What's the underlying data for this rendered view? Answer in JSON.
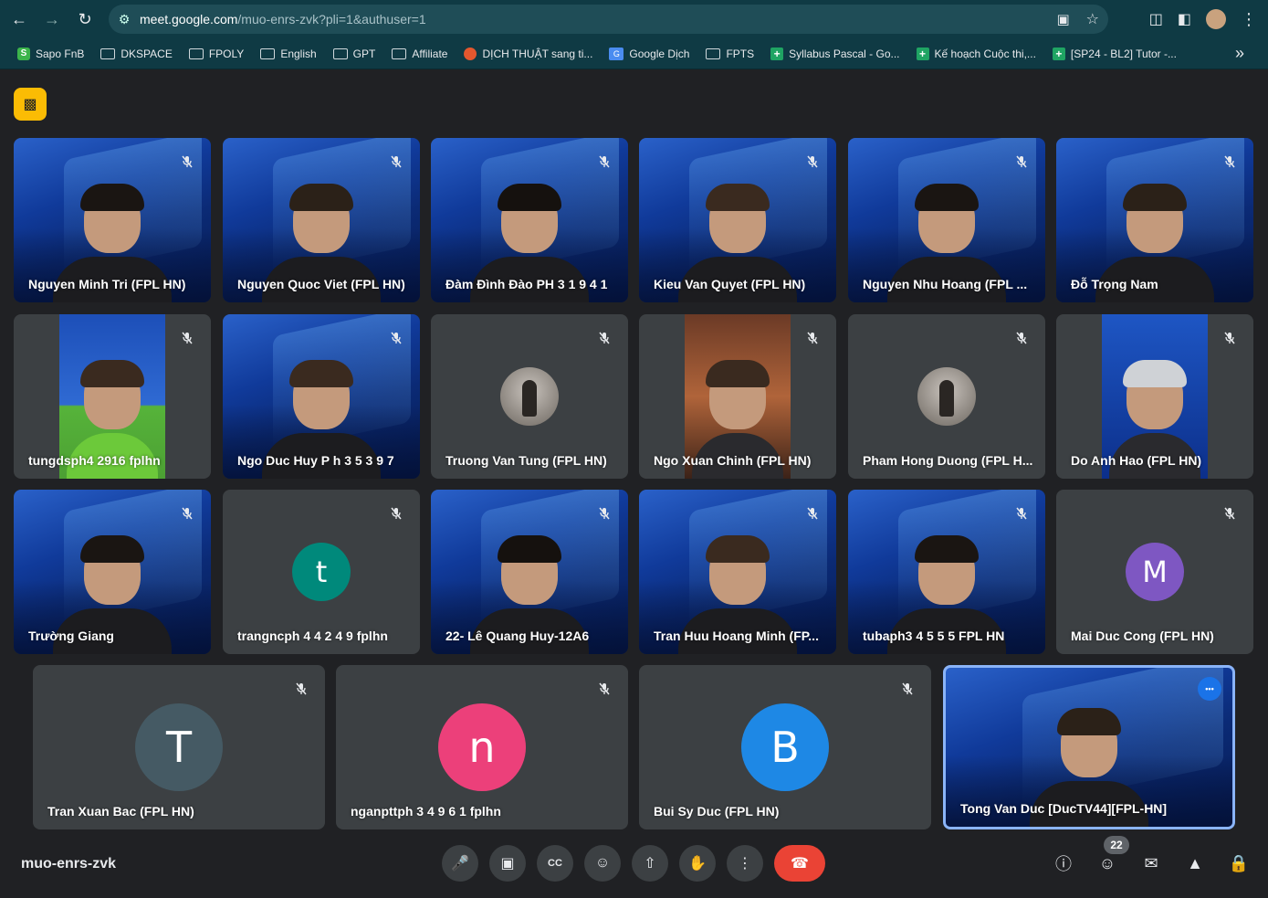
{
  "browser": {
    "url_host": "meet.google.com",
    "url_path": "/muo-enrs-zvk?pli=1&authuser=1",
    "bookmarks": [
      {
        "label": "Sapo FnB",
        "icon": "s-icon"
      },
      {
        "label": "DKSPACE",
        "icon": "folder-icon"
      },
      {
        "label": "FPOLY",
        "icon": "folder-icon"
      },
      {
        "label": "English",
        "icon": "folder-icon"
      },
      {
        "label": "GPT",
        "icon": "folder-icon"
      },
      {
        "label": "Affiliate",
        "icon": "folder-icon"
      },
      {
        "label": "DỊCH THUẬT sang ti...",
        "icon": "translate-site-icon"
      },
      {
        "label": "Google Dịch",
        "icon": "google-translate-icon"
      },
      {
        "label": "FPTS",
        "icon": "folder-icon"
      },
      {
        "label": "Syllabus Pascal - Go...",
        "icon": "sheets-icon"
      },
      {
        "label": "Kế hoạch Cuộc thi,...",
        "icon": "sheets-icon"
      },
      {
        "label": "[SP24 - BL2] Tutor -...",
        "icon": "sheets-icon"
      }
    ],
    "bookmarks_more": "»"
  },
  "participants": [
    {
      "name": "Nguyen Minh Tri (FPL HN)",
      "type": "video"
    },
    {
      "name": "Nguyen Quoc Viet (FPL HN)",
      "type": "video"
    },
    {
      "name": "Đàm Đình Đào PH 3 1 9 4 1",
      "type": "video"
    },
    {
      "name": "Kieu Van Quyet (FPL HN)",
      "type": "video"
    },
    {
      "name": "Nguyen Nhu Hoang (FPL ...",
      "type": "video"
    },
    {
      "name": "Đỗ Trọng Nam",
      "type": "video"
    },
    {
      "name": "tungdsph4 2916 fplhn",
      "type": "strip"
    },
    {
      "name": "Ngo Duc Huy P h 3 5 3 9 7",
      "type": "video"
    },
    {
      "name": "Truong Van Tung (FPL HN)",
      "type": "photo"
    },
    {
      "name": "Ngo Xuan Chinh (FPL HN)",
      "type": "strip"
    },
    {
      "name": "Pham Hong Duong (FPL H...",
      "type": "photo"
    },
    {
      "name": "Do Anh Hao (FPL HN)",
      "type": "strip"
    },
    {
      "name": "Trường Giang",
      "type": "video"
    },
    {
      "name": "trangncph 4 4 2 4 9 fplhn",
      "type": "letter",
      "letter": "t",
      "color": "#00897b"
    },
    {
      "name": "22- Lê Quang Huy-12A6",
      "type": "video"
    },
    {
      "name": "Tran Huu Hoang Minh (FP...",
      "type": "video"
    },
    {
      "name": "tubaph3 4 5 5 5 FPL HN",
      "type": "video"
    },
    {
      "name": "Mai Duc Cong (FPL HN)",
      "type": "letter",
      "letter": "M",
      "color": "#7e57c2"
    },
    {
      "name": "Tran Xuan Bac (FPL HN)",
      "type": "letter",
      "letter": "T",
      "color": "#455a64"
    },
    {
      "name": "nganpttph 3 4 9 6 1 fplhn",
      "type": "letter",
      "letter": "n",
      "color": "#ec407a"
    },
    {
      "name": "Bui Sy Duc (FPL HN)",
      "type": "letter",
      "letter": "B",
      "color": "#1e88e5"
    },
    {
      "name": "Tong Van Duc [DucTV44][FPL-HN]",
      "type": "video",
      "active": true
    }
  ],
  "meeting": {
    "code": "muo-enrs-zvk",
    "participant_count": "22"
  },
  "colors": {
    "end_call": "#ea4335",
    "recording_badge": "#fbbc04",
    "active_border": "#8ab4f8"
  }
}
